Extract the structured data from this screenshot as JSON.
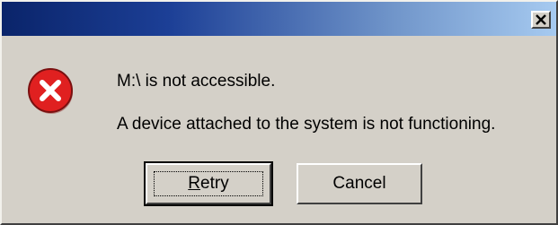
{
  "dialog": {
    "title": "",
    "close_glyph": "✕",
    "icon": "error-icon",
    "messages": [
      "M:\\ is not accessible.",
      "A device attached to the system is not functioning."
    ],
    "buttons": {
      "retry_label": "Retry",
      "cancel_label": "Cancel"
    }
  },
  "colors": {
    "titlebar_start": "#0a246a",
    "titlebar_end": "#a6caf0",
    "dialog_face": "#d4d0c8",
    "error_red": "#e02020"
  }
}
